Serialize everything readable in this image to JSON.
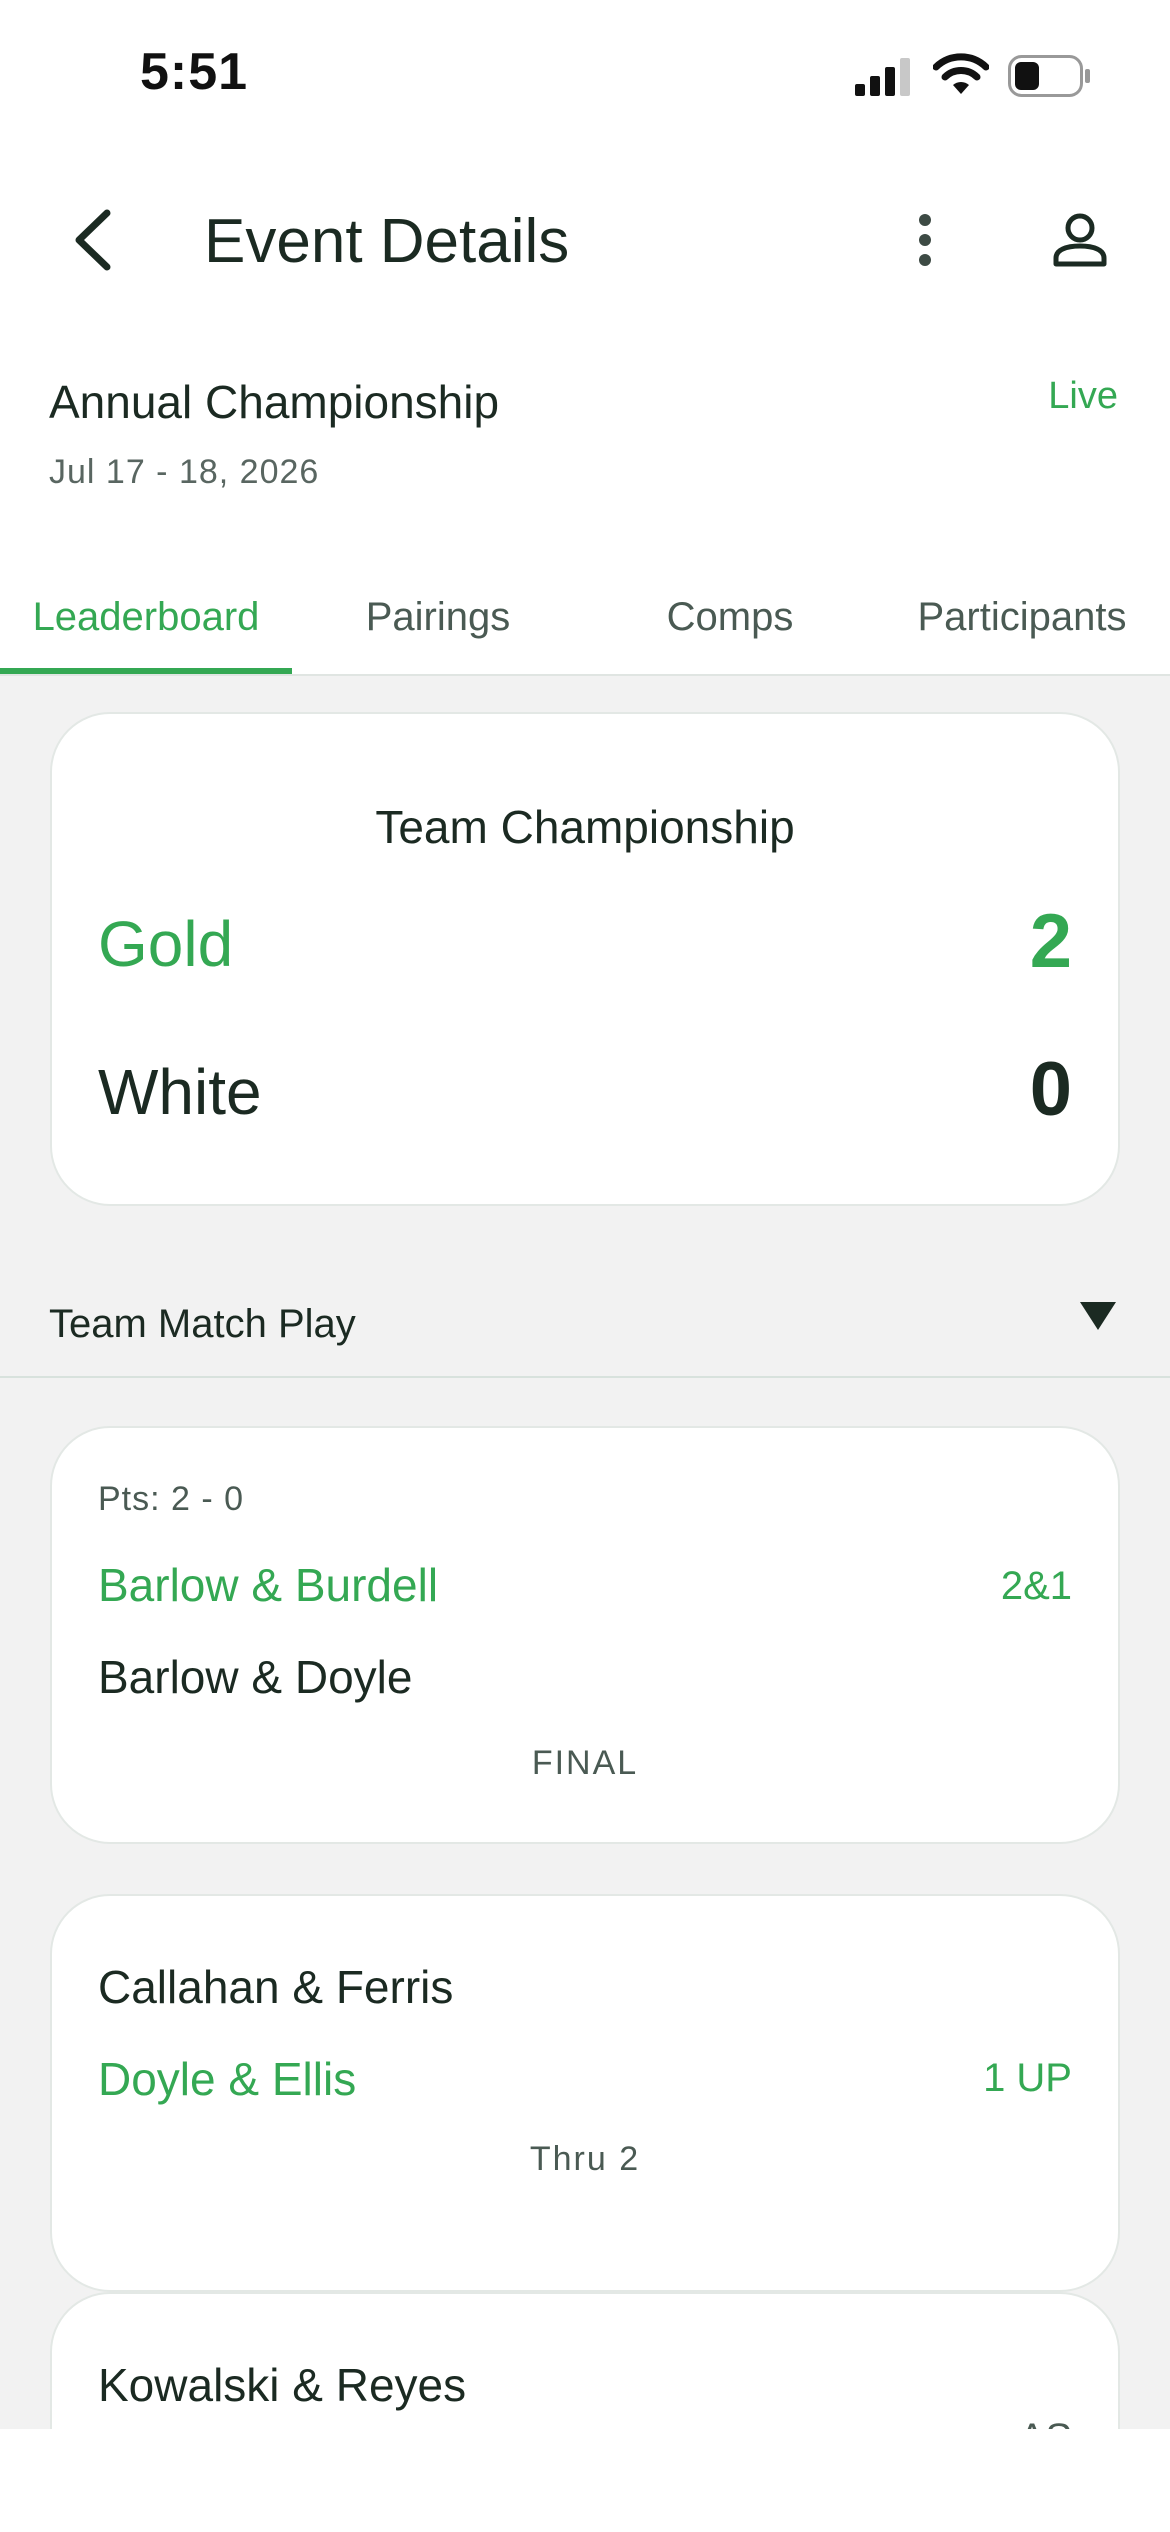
{
  "status_bar": {
    "time": "5:51",
    "icons": [
      "signal-icon",
      "wifi-icon",
      "battery-icon"
    ]
  },
  "header": {
    "title": "Event Details",
    "back_icon": "chevron-left-icon",
    "more_icon": "more-vertical-icon",
    "profile_icon": "person-icon"
  },
  "event": {
    "name": "Annual Championship",
    "dates": "Jul 17 - 18, 2026",
    "status": "Live"
  },
  "tabs": [
    {
      "label": "Leaderboard",
      "active": true
    },
    {
      "label": "Pairings",
      "active": false
    },
    {
      "label": "Comps",
      "active": false
    },
    {
      "label": "Participants",
      "active": false
    }
  ],
  "team_championship": {
    "title": "Team Championship",
    "teams": [
      {
        "name": "Gold",
        "score": "2"
      },
      {
        "name": "White",
        "score": "0"
      }
    ]
  },
  "section": {
    "label": "Team Match Play",
    "dropdown_icon": "triangle-down-icon"
  },
  "matches": [
    {
      "points": "Pts: 2 - 0",
      "pair_1": "Barlow & Burdell",
      "pair_2": "Barlow & Doyle",
      "result": "2&1",
      "status": "FINAL"
    },
    {
      "pair_1": "Callahan & Ferris",
      "pair_2": "Doyle & Ellis",
      "result": "1 UP",
      "status": "Thru 2"
    },
    {
      "pair_1": "Kowalski & Reyes",
      "result": "AS"
    }
  ],
  "colors": {
    "accent": "#34a853",
    "text_dark": "#1b2a22",
    "background": "#f2f2f2"
  }
}
